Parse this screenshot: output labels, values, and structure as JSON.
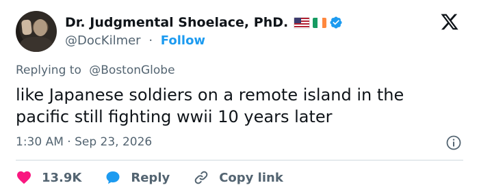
{
  "author": {
    "display_name": "Dr. Judgmental Shoelace, PhD.",
    "handle": "@DocKilmer",
    "separator": "·",
    "follow_label": "Follow",
    "badges": [
      "us-flag-icon",
      "ireland-flag-icon",
      "verified-badge-icon"
    ],
    "verified_color": "#1d9bf0"
  },
  "platform_icon": "x-logo-icon",
  "reply_context": {
    "prefix": "Replying to",
    "target": "@BostonGlobe"
  },
  "tweet": {
    "text": "like Japanese soldiers on a remote island in the pacific still fighting wwii 10 years later",
    "timestamp": "1:30 AM · Sep 23, 2026"
  },
  "actions": {
    "like_count": "13.9K",
    "reply_label": "Reply",
    "copy_link_label": "Copy link"
  },
  "colors": {
    "text": "#0f1419",
    "muted": "#536471",
    "accent": "#1d9bf0",
    "like": "#f91880",
    "divider": "#cfd9de"
  }
}
